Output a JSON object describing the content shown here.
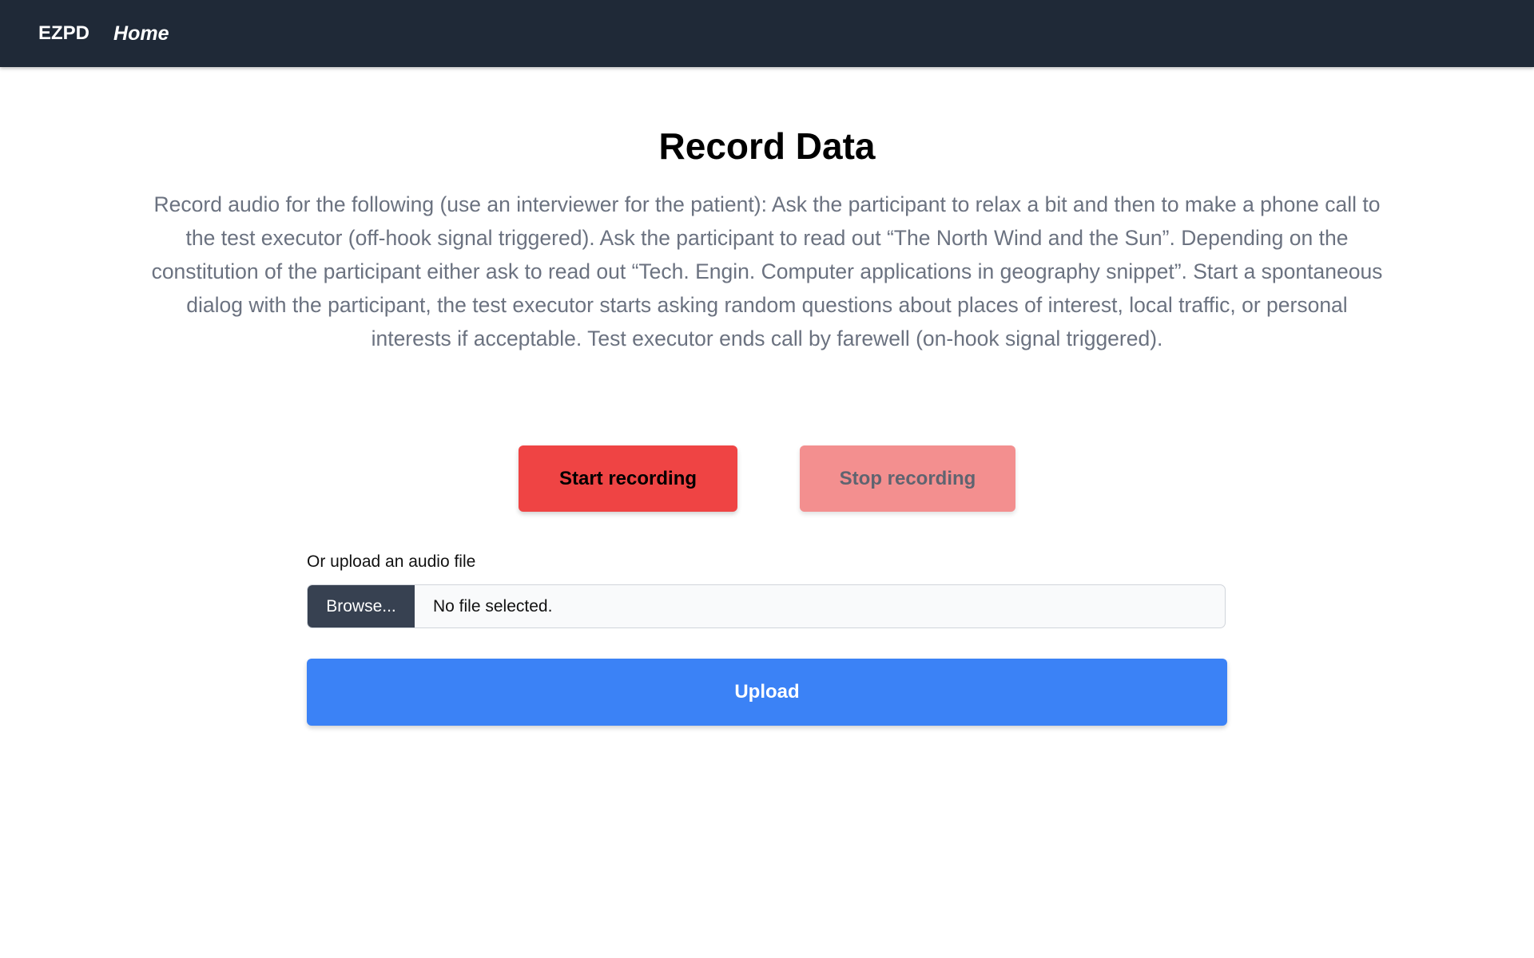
{
  "nav": {
    "brand": "EZPD",
    "home": "Home"
  },
  "page": {
    "title": "Record Data",
    "description": "Record audio for the following (use an interviewer for the patient): Ask the participant to relax a bit and then to make a phone call to the test executor (off-hook signal triggered). Ask the participant to read out “The North Wind and the Sun”. Depending on the constitution of the participant either ask to read out “Tech. Engin. Computer applications in geography snippet”. Start a spontaneous dialog with the participant, the test executor starts asking random questions about places of interest, local traffic, or personal interests if acceptable. Test executor ends call by farewell (on-hook signal triggered)."
  },
  "recording": {
    "start_label": "Start recording",
    "stop_label": "Stop recording",
    "stop_enabled": false
  },
  "upload": {
    "label": "Or upload an audio file",
    "browse_label": "Browse...",
    "file_status": "No file selected.",
    "button_label": "Upload"
  },
  "colors": {
    "navbar": "#1f2937",
    "start_button": "#ef4444",
    "stop_button_disabled": "#f38f8f",
    "upload_button": "#3b82f6",
    "browse_button": "#374151",
    "description_text": "#6b7280"
  }
}
